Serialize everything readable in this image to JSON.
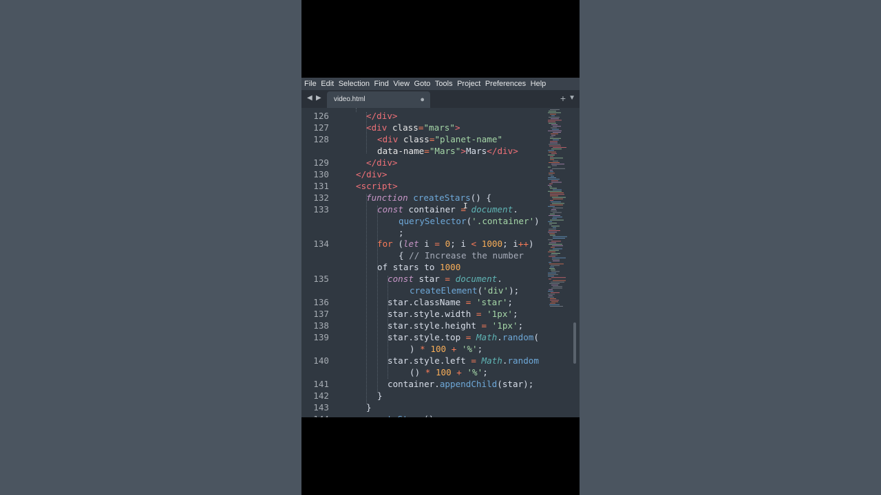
{
  "menu": [
    "File",
    "Edit",
    "Selection",
    "Find",
    "View",
    "Goto",
    "Tools",
    "Project",
    "Preferences",
    "Help"
  ],
  "tab": {
    "title": "video.html"
  },
  "code_lines": [
    {
      "num": "126",
      "text": "</div>"
    },
    {
      "num": "127",
      "text": "<div class=\"mars\">"
    },
    {
      "num": "128",
      "text": "<div class=\"planet-name\""
    },
    {
      "num": "",
      "text": "data-name=\"Mars\">Mars</div>"
    },
    {
      "num": "129",
      "text": "</div>"
    },
    {
      "num": "130",
      "text": "</div>"
    },
    {
      "num": "131",
      "text": "<script>"
    },
    {
      "num": "132",
      "text": "function createStars() {"
    },
    {
      "num": "133",
      "text": "const container = document."
    },
    {
      "num": "",
      "text": "querySelector('.container')"
    },
    {
      "num": "",
      "text": ";"
    },
    {
      "num": "134",
      "text": "for (let i = 0; i < 1000; i++)"
    },
    {
      "num": "",
      "text": "{ // Increase the number"
    },
    {
      "num": "",
      "text": "of stars to 1000"
    },
    {
      "num": "135",
      "text": "const star = document."
    },
    {
      "num": "",
      "text": "createElement('div');"
    },
    {
      "num": "136",
      "text": "star.className = 'star';"
    },
    {
      "num": "137",
      "text": "star.style.width = '1px';"
    },
    {
      "num": "138",
      "text": "star.style.height = '1px';"
    },
    {
      "num": "139",
      "text": "star.style.top = Math.random("
    },
    {
      "num": "",
      "text": ") * 100 + '%';"
    },
    {
      "num": "140",
      "text": "star.style.left = Math.random"
    },
    {
      "num": "",
      "text": "() * 100 + '%';"
    },
    {
      "num": "141",
      "text": "container.appendChild(star);"
    },
    {
      "num": "142",
      "text": "}"
    },
    {
      "num": "143",
      "text": "}"
    },
    {
      "num": "144",
      "text": "createStars();"
    }
  ]
}
